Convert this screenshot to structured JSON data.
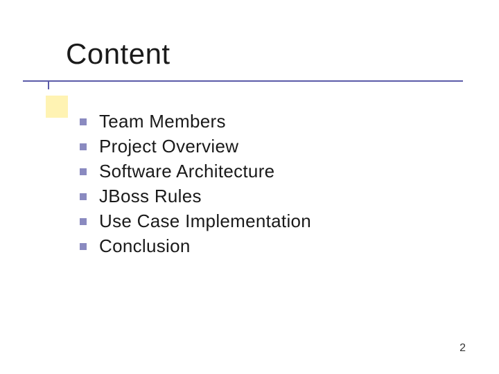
{
  "slide": {
    "title": "Content",
    "items": [
      {
        "label": "Team Members"
      },
      {
        "label": "Project Overview"
      },
      {
        "label": "Software Architecture"
      },
      {
        "label": "JBoss Rules"
      },
      {
        "label": "Use Case Implementation"
      },
      {
        "label": "Conclusion"
      }
    ],
    "page_number": "2"
  }
}
